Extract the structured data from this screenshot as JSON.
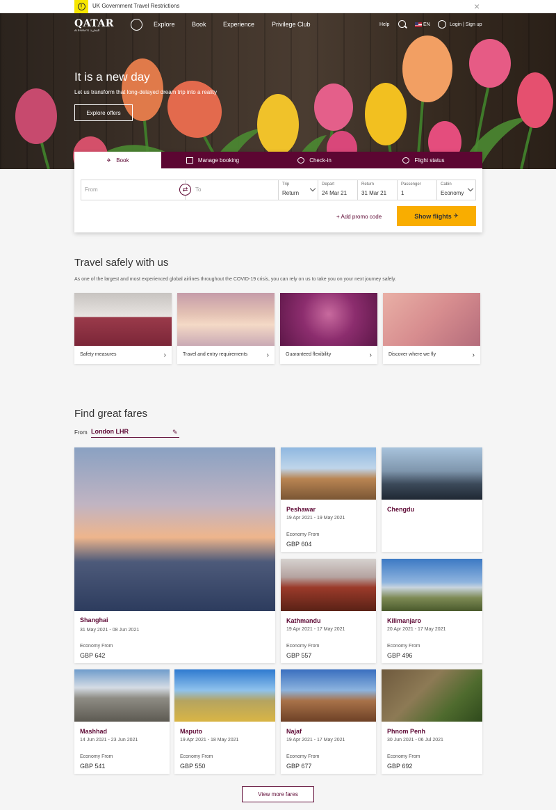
{
  "alert": {
    "text": "UK Government Travel Restrictions",
    "icon": "info-icon",
    "close": "×"
  },
  "nav": {
    "logo": "QATAR",
    "logo_sub": "AIRWAYS القطرية",
    "links": [
      "Explore",
      "Book",
      "Experience",
      "Privilege Club"
    ],
    "help": "Help",
    "language": "EN",
    "login": "Login | Sign up"
  },
  "hero": {
    "title": "It is a new day",
    "subtitle": "Let us transform that long-delayed dream trip into a reality",
    "button": "Explore offers"
  },
  "booking": {
    "tabs": [
      {
        "label": "Book",
        "icon": "plane-icon"
      },
      {
        "label": "Manage booking",
        "icon": "calendar-icon"
      },
      {
        "label": "Check-in",
        "icon": "check-icon"
      },
      {
        "label": "Flight status",
        "icon": "location-icon"
      }
    ],
    "from_placeholder": "From",
    "to_placeholder": "To",
    "trip_label": "Trip",
    "trip_value": "Return",
    "depart_label": "Depart",
    "depart_value": "24 Mar 21",
    "return_label": "Return",
    "return_value": "31 Mar 21",
    "passenger_label": "Passenger",
    "passenger_value": "1",
    "cabin_label": "Cabin",
    "cabin_value": "Economy",
    "promo": "+ Add promo code",
    "show_flights": "Show flights"
  },
  "safety": {
    "title": "Travel safely with us",
    "description": "As one of the largest and most experienced global airlines throughout the COVID-19 crisis, you can rely on us to take you on your next journey safely.",
    "cards": [
      "Safety measures",
      "Travel and entry requirements",
      "Guaranteed flexibility",
      "Discover where we fly"
    ]
  },
  "fares": {
    "title": "Find great fares",
    "from_label": "From",
    "from_value": "London LHR",
    "economy_label": "Economy From",
    "items": [
      {
        "city": "Shanghai",
        "dates": "31 May 2021 - 08 Jun 2021",
        "price": "GBP 642"
      },
      {
        "city": "Peshawar",
        "dates": "19 Apr 2021 - 19 May 2021",
        "price": "GBP 604"
      },
      {
        "city": "Chengdu",
        "dates": "",
        "price": ""
      },
      {
        "city": "Kathmandu",
        "dates": "19 Apr 2021 - 17 May 2021",
        "price": "GBP 557"
      },
      {
        "city": "Kilimanjaro",
        "dates": "20 Apr 2021 - 17 May 2021",
        "price": "GBP 496"
      },
      {
        "city": "Mashhad",
        "dates": "14 Jun 2021 - 23 Jun 2021",
        "price": "GBP 541"
      },
      {
        "city": "Maputo",
        "dates": "19 Apr 2021 - 18 May 2021",
        "price": "GBP 550"
      },
      {
        "city": "Najaf",
        "dates": "19 Apr 2021 - 17 May 2021",
        "price": "GBP 677"
      },
      {
        "city": "Phnom Penh",
        "dates": "30 Jun 2021 - 06 Jul 2021",
        "price": "GBP 692"
      }
    ],
    "more_button": "View more fares"
  },
  "colors": {
    "brand": "#5c0632",
    "accent": "#f9ad00",
    "alert": "#f7e600"
  }
}
